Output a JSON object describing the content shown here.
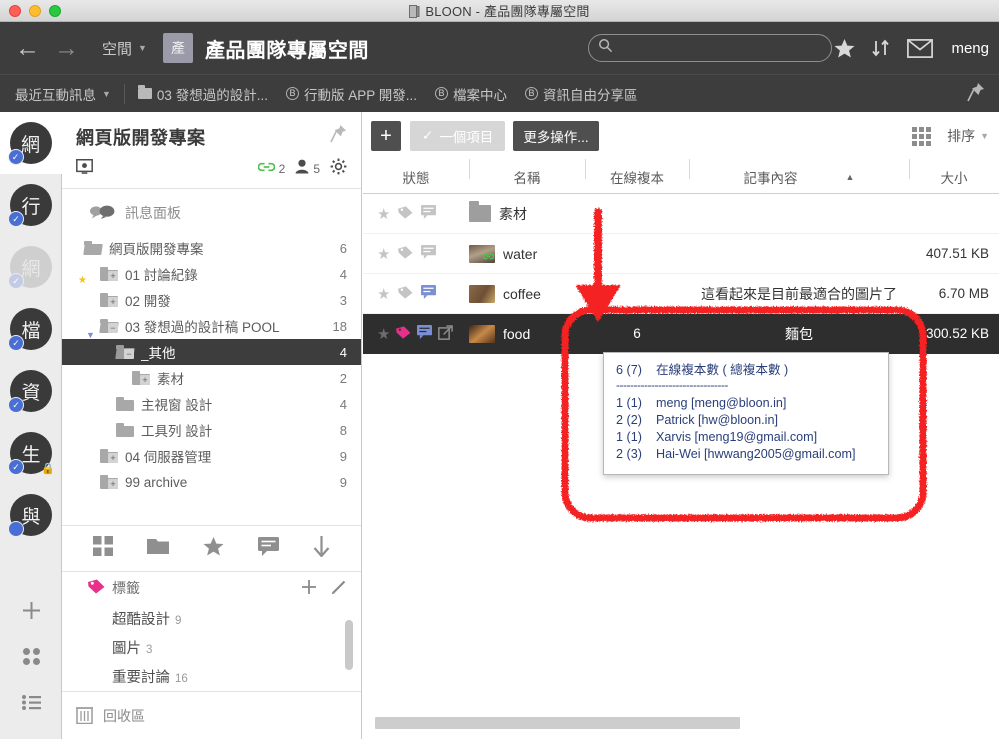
{
  "window": {
    "title": "BLOON - 產品團隊專屬空間",
    "doc_icon": "document-icon"
  },
  "topnav": {
    "back_icon": "←",
    "forward_icon": "→",
    "space_menu_label": "空間",
    "space_badge": "產",
    "space_title": "產品團隊專屬空間",
    "search_placeholder": "",
    "search_value": "",
    "star_icon": "star-icon",
    "sort_icon": "sort-arrows-icon",
    "mail_icon": "mail-icon",
    "user_name": "meng"
  },
  "tabsbar": {
    "recent_label": "最近互動訊息",
    "tabs": [
      {
        "icon": "folder-icon",
        "label": "03 發想過的設計..."
      },
      {
        "icon": "bloon-circle-icon",
        "label": "行動版 APP 開發..."
      },
      {
        "icon": "bloon-circle-icon",
        "label": "檔案中心"
      },
      {
        "icon": "bloon-circle-icon",
        "label": "資訊自由分享區"
      }
    ],
    "pin_icon": "pin-icon"
  },
  "rail": {
    "items": [
      {
        "label": "網",
        "state": "active",
        "badge": "check"
      },
      {
        "label": "行",
        "state": "normal",
        "badge": "check"
      },
      {
        "label": "網",
        "state": "disabled",
        "badge": "check-dim"
      },
      {
        "label": "檔",
        "state": "normal",
        "badge": "check"
      },
      {
        "label": "資",
        "state": "normal",
        "badge": "check"
      },
      {
        "label": "生",
        "state": "normal",
        "badge": "check",
        "lock": true
      },
      {
        "label": "與",
        "state": "normal",
        "badge": "dot"
      }
    ],
    "bottom_buttons": [
      {
        "name": "add-space-button",
        "icon": "plus-icon"
      },
      {
        "name": "grid-view-button",
        "icon": "four-dots-icon"
      },
      {
        "name": "list-view-button",
        "icon": "list-icon"
      }
    ]
  },
  "sidebar": {
    "project_title": "網頁版開發專案",
    "pin_icon": "pin-icon",
    "screen_icon": "screen-share-icon",
    "link_count": "2",
    "member_count": "5",
    "gear_icon": "gear-icon",
    "message_panel_label": "訊息面板",
    "tree": [
      {
        "label": "網頁版開發專案",
        "count": "6",
        "indent": 0,
        "icon": "folder-check",
        "selected": false
      },
      {
        "label": "01 討論紀錄",
        "count": "4",
        "indent": 1,
        "icon": "folder-plus",
        "star": true,
        "selected": false
      },
      {
        "label": "02 開發",
        "count": "3",
        "indent": 1,
        "icon": "folder-plus",
        "selected": false
      },
      {
        "label": "03 發想過的設計稿 POOL",
        "count": "18",
        "indent": 1,
        "icon": "folder-minus-open",
        "download": true,
        "selected": false
      },
      {
        "label": "_其他",
        "count": "4",
        "indent": 2,
        "icon": "folder-minus-open",
        "selected": true
      },
      {
        "label": "素材",
        "count": "2",
        "indent": 3,
        "icon": "folder-plus",
        "selected": false
      },
      {
        "label": "主視窗 設計",
        "count": "4",
        "indent": 2,
        "icon": "folder-solid",
        "selected": false
      },
      {
        "label": "工具列 設計",
        "count": "8",
        "indent": 2,
        "icon": "folder-solid",
        "selected": false
      },
      {
        "label": "04 伺服器管理",
        "count": "9",
        "indent": 1,
        "icon": "folder-plus",
        "selected": false
      },
      {
        "label": "99 archive",
        "count": "9",
        "indent": 1,
        "icon": "folder-plus",
        "selected": false
      }
    ],
    "tools": [
      {
        "name": "grid-tool-icon",
        "icon": "grid-icon"
      },
      {
        "name": "folder-tool-icon",
        "icon": "folder-icon"
      },
      {
        "name": "favorite-tool-icon",
        "icon": "star-icon"
      },
      {
        "name": "comment-tool-icon",
        "icon": "comment-icon"
      },
      {
        "name": "download-tool-icon",
        "icon": "arrow-down-icon"
      }
    ],
    "tags_header": "標籤",
    "tags_add_icon": "plus-icon",
    "tags_edit_icon": "pencil-icon",
    "tags": [
      {
        "label": "超酷設計",
        "count": "9"
      },
      {
        "label": "圖片",
        "count": "3"
      },
      {
        "label": "重要討論",
        "count": "16"
      }
    ],
    "trash_label": "回收區",
    "trash_icon": "trash-icon"
  },
  "main": {
    "toolbar": {
      "add_label": "+",
      "select_label": "一個項目",
      "select_check": "✓",
      "more_label": "更多操作...",
      "grid_icon": "grid-view-icon",
      "sort_label": "排序"
    },
    "columns": [
      {
        "key": "state",
        "label": "狀態"
      },
      {
        "key": "name",
        "label": "名稱"
      },
      {
        "key": "copy",
        "label": "在線複本"
      },
      {
        "key": "note",
        "label": "記事內容",
        "sorted": "asc",
        "sort_caret": "▲"
      },
      {
        "key": "size",
        "label": "大小"
      }
    ],
    "rows": [
      {
        "icons": [
          "star-outline",
          "tag-outline",
          "comment-outline"
        ],
        "thumb": "folder",
        "name": "素材",
        "copy": "",
        "note": "",
        "size": "",
        "selected": false
      },
      {
        "icons": [
          "star-outline",
          "tag-outline",
          "comment-outline"
        ],
        "thumb": "water-image",
        "name": "water",
        "copy": "",
        "note": "",
        "size": "407.51 KB",
        "selected": false
      },
      {
        "icons": [
          "star-outline",
          "tag-outline",
          "comment-active"
        ],
        "thumb": "coffee-image",
        "name": "coffee",
        "copy": "",
        "note": "這看起來是目前最適合的圖片了",
        "size": "6.70 MB",
        "selected": false
      },
      {
        "icons": [
          "star-outline",
          "tag-pink",
          "comment-active",
          "external-link"
        ],
        "thumb": "food-image",
        "name": "food",
        "copy": "6",
        "note": "麵包",
        "size": "300.52 KB",
        "selected": true
      }
    ]
  },
  "tooltip": {
    "header_count": "6 (7)",
    "header_label": "在線複本數 ( 總複本數 )",
    "separator": "--------------------------------",
    "entries": [
      {
        "count": "1 (1)",
        "text": "meng [meng@bloon.in]"
      },
      {
        "count": "2 (2)",
        "text": "Patrick [hw@bloon.in]"
      },
      {
        "count": "1 (1)",
        "text": "Xarvis [meng19@gmail.com]"
      },
      {
        "count": "2 (3)",
        "text": "Hai-Wei [hwwang2005@gmail.com]"
      }
    ]
  },
  "annotation": {
    "color": "#f42020",
    "shape": "rounded-rect-with-down-arrow",
    "target": "food-row-online-copy-count"
  },
  "colors": {
    "dark_nav": "#3d3d3d",
    "selected_row": "#2e2e2e",
    "accent_blue": "#4a6fd4",
    "tag_pink": "#e8308a",
    "annotation_red": "#f42020",
    "tooltip_text": "#2a3f7a"
  }
}
